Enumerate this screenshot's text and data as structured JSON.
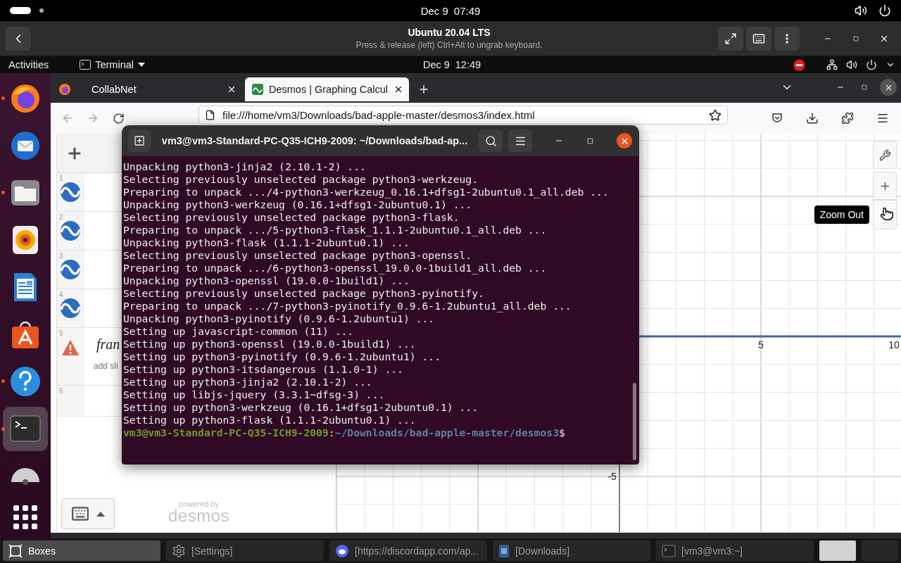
{
  "host_bar": {
    "date": "Dec 9",
    "time": "07:49"
  },
  "boxes_header": {
    "title": "Ubuntu 20.04 LTS",
    "subtitle": "Press & release (left) Ctrl+Alt to ungrab keyboard."
  },
  "guest_bar": {
    "activities": "Activities",
    "app_menu": "Terminal",
    "date": "Dec 9",
    "time": "12:49"
  },
  "dock": [
    {
      "kind": "browser",
      "running": true,
      "active": false
    },
    {
      "kind": "mail",
      "running": false,
      "active": false
    },
    {
      "kind": "files",
      "running": true,
      "active": false
    },
    {
      "kind": "music",
      "running": false,
      "active": false
    },
    {
      "kind": "writer",
      "running": false,
      "active": false
    },
    {
      "kind": "store",
      "running": false,
      "active": false
    },
    {
      "kind": "help",
      "running": true,
      "active": false
    },
    {
      "kind": "terminal",
      "running": true,
      "active": true
    },
    {
      "kind": "disc",
      "running": false,
      "active": false
    }
  ],
  "browser": {
    "tabs": [
      {
        "label": "CollabNet",
        "kind": "plain",
        "selected": false
      },
      {
        "label": "Desmos | Graphing Calcul",
        "kind": "desmos",
        "selected": true
      }
    ],
    "url": "file:///home/vm3/Downloads/bad-apple-master/desmos3/index.html"
  },
  "desmos": {
    "expressions": [
      {
        "number": "1",
        "kind": "wave"
      },
      {
        "number": "2",
        "kind": "wave"
      },
      {
        "number": "3",
        "kind": "wave"
      },
      {
        "number": "4",
        "kind": "wave"
      },
      {
        "number": "5",
        "kind": "warning",
        "text": "fran",
        "hint": "add sli"
      },
      {
        "number": "6",
        "kind": "empty"
      }
    ],
    "powered_by": "powered by",
    "brand": "desmos",
    "graph": {
      "x_tick_labels": [
        "5",
        "10"
      ],
      "y_tick_labels": [
        "-5"
      ]
    },
    "tooltip": "Zoom Out"
  },
  "terminal": {
    "title": "vm3@vm3-Standard-PC-Q35-ICH9-2009: ~/Downloads/bad-ap...",
    "lines": [
      "Unpacking python3-jinja2 (2.10.1-2) ...",
      "Selecting previously unselected package python3-werkzeug.",
      "Preparing to unpack .../4-python3-werkzeug_0.16.1+dfsg1-2ubuntu0.1_all.deb ...",
      "Unpacking python3-werkzeug (0.16.1+dfsg1-2ubuntu0.1) ...",
      "Selecting previously unselected package python3-flask.",
      "Preparing to unpack .../5-python3-flask_1.1.1-2ubuntu0.1_all.deb ...",
      "Unpacking python3-flask (1.1.1-2ubuntu0.1) ...",
      "Selecting previously unselected package python3-openssl.",
      "Preparing to unpack .../6-python3-openssl_19.0.0-1build1_all.deb ...",
      "Unpacking python3-openssl (19.0.0-1build1) ...",
      "Selecting previously unselected package python3-pyinotify.",
      "Preparing to unpack .../7-python3-pyinotify_0.9.6-1.2ubuntu1_all.deb ...",
      "Unpacking python3-pyinotify (0.9.6-1.2ubuntu1) ...",
      "Setting up javascript-common (11) ...",
      "Setting up python3-openssl (19.0.0-1build1) ...",
      "Setting up python3-pyinotify (0.9.6-1.2ubuntu1) ...",
      "Setting up python3-itsdangerous (1.1.0-1) ...",
      "Setting up python3-jinja2 (2.10.1-2) ...",
      "Setting up libjs-jquery (3.3.1~dfsg-3) ...",
      "Setting up python3-werkzeug (0.16.1+dfsg1-2ubuntu0.1) ...",
      "Setting up python3-flask (1.1.1-2ubuntu0.1) ..."
    ],
    "prompt": {
      "user": "vm3@vm3-Standard-PC-Q35-ICH9-2009",
      "separator": ":",
      "path": "~/Downloads/bad-apple-master/desmos3",
      "symbol": "$"
    }
  },
  "taskbar": [
    {
      "label": "Boxes",
      "kind": "boxes",
      "selected": true
    },
    {
      "label": "[Settings]",
      "kind": "settings",
      "selected": false
    },
    {
      "label": "[https://discordapp.com/ap...",
      "kind": "chat",
      "selected": false
    },
    {
      "label": "[Downloads]",
      "kind": "files",
      "selected": false
    },
    {
      "label": "[vm3@vm3:~]",
      "kind": "terminal",
      "selected": false
    }
  ],
  "workspaces": [
    {
      "selected": true
    },
    {
      "selected": false
    }
  ]
}
